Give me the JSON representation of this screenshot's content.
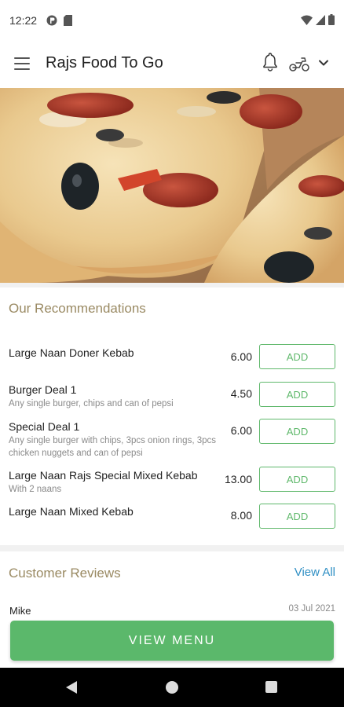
{
  "status_bar": {
    "time": "12:22",
    "left_icons": [
      "app-notification-icon",
      "sd-card-icon"
    ],
    "right_icons": [
      "wifi-icon",
      "signal-icon",
      "battery-icon"
    ]
  },
  "app_bar": {
    "title": "Rajs Food To Go",
    "icons": [
      "menu-icon",
      "bell-icon",
      "scooter-icon",
      "chevron-down-icon"
    ]
  },
  "hero": {
    "image": "pizza-photo"
  },
  "recommendations": {
    "title": "Our Recommendations",
    "add_label": "ADD",
    "items": [
      {
        "name": "Large Naan Doner Kebab",
        "description": "",
        "price": "6.00"
      },
      {
        "name": "Burger Deal 1",
        "description": "Any single burger, chips and can of pepsi",
        "price": "4.50"
      },
      {
        "name": "Special Deal 1",
        "description": "Any single burger with chips, 3pcs onion rings, 3pcs chicken nuggets and can of pepsi",
        "price": "6.00"
      },
      {
        "name": "Large Naan Rajs Special Mixed Kebab",
        "description": "With 2 naans",
        "price": "13.00"
      },
      {
        "name": "Large Naan Mixed Kebab",
        "description": "",
        "price": "8.00"
      }
    ]
  },
  "reviews": {
    "title": "Customer Reviews",
    "view_all": "View All",
    "first_review": {
      "name": "Mike",
      "date": "03 Jul 2021"
    }
  },
  "view_menu_button": "VIEW MENU",
  "colors": {
    "accent_green": "#5bb86b",
    "section_title": "#9a8a63",
    "link_blue": "#2f8fc4"
  }
}
